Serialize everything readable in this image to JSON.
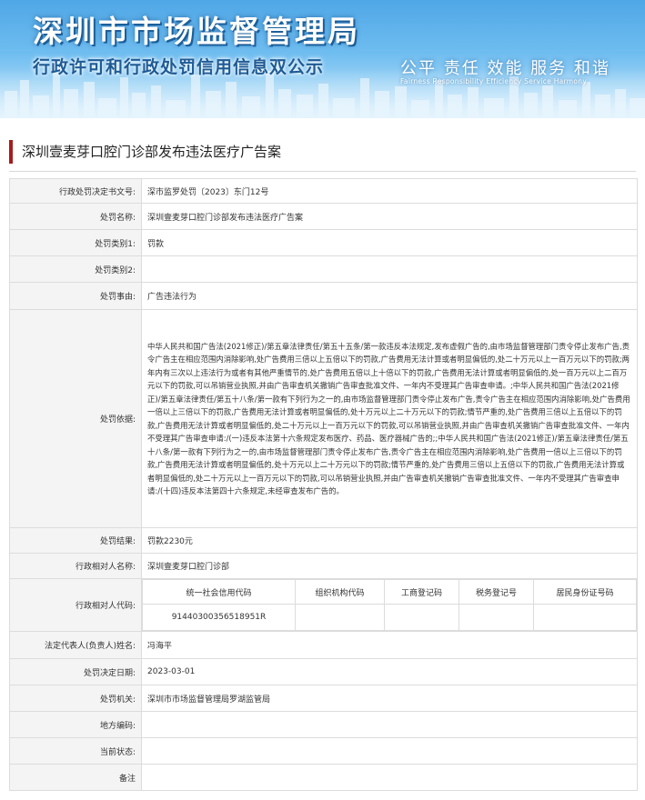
{
  "banner": {
    "title": "深圳市市场监督管理局",
    "subtitle": "行政许可和行政处罚信用信息双公示",
    "slogan": "公平  责任  效能  服务  和谐",
    "slogan_en": "Fairness  Responsibility  Efficiency  Service  Harmony"
  },
  "case_title": "深圳壹麦芽口腔门诊部发布违法医疗广告案",
  "rows": [
    {
      "label": "行政处罚决定书文号:",
      "value": "深市监罗处罚〔2023〕东门12号"
    },
    {
      "label": "处罚名称:",
      "value": "深圳壹麦芽口腔门诊部发布违法医疗广告案"
    },
    {
      "label": "处罚类别1:",
      "value": "罚款"
    },
    {
      "label": "处罚类别2:",
      "value": ""
    },
    {
      "label": "处罚事由:",
      "value": "广告违法行为"
    },
    {
      "label": "处罚依据:",
      "value": "中华人民共和国广告法(2021修正)/第五章法律责任/第五十五条/第一款违反本法规定,发布虚假广告的,由市场监督管理部门责令停止发布广告,责令广告主在相应范围内消除影响,处广告费用三倍以上五倍以下的罚款,广告费用无法计算或者明显偏低的,处二十万元以上一百万元以下的罚款;两年内有三次以上违法行为或者有其他严重情节的,处广告费用五倍以上十倍以下的罚款,广告费用无法计算或者明显偏低的,处一百万元以上二百万元以下的罚款,可以吊销营业执照,并由广告审查机关撤销广告审查批准文件、一年内不受理其广告审查申请。;中华人民共和国广告法(2021修正)/第五章法律责任/第五十八条/第一款有下列行为之一的,由市场监督管理部门责令停止发布广告,责令广告主在相应范围内消除影响,处广告费用一倍以上三倍以下的罚款,广告费用无法计算或者明显偏低的,处十万元以上二十万元以下的罚款;情节严重的,处广告费用三倍以上五倍以下的罚款,广告费用无法计算或者明显偏低的,处二十万元以上一百万元以下的罚款,可以吊销营业执照,并由广告审查机关撤销广告审查批准文件、一年内不受理其广告审查申请:/(一)违反本法第十六条规定发布医疗、药品、医疗器械广告的;;中华人民共和国广告法(2021修正)/第五章法律责任/第五十八条/第一款有下列行为之一的,由市场监督管理部门责令停止发布广告,责令广告主在相应范围内消除影响,处广告费用一倍以上三倍以下的罚款,广告费用无法计算或者明显偏低的,处十万元以上二十万元以下的罚款;情节严重的,处广告费用三倍以上五倍以下的罚款,广告费用无法计算或者明显偏低的,处二十万元以上一百万元以下的罚款,可以吊销营业执照,并由广告审查机关撤销广告审查批准文件、一年内不受理其广告审查申请:/(十四)违反本法第四十六条规定,未经审查发布广告的。"
    },
    {
      "label": "处罚结果:",
      "value": "罚款2230元"
    },
    {
      "label": "行政相对人名称:",
      "value": "深圳壹麦芽口腔门诊部"
    }
  ],
  "codes": {
    "label": "行政相对人代码:",
    "headers": [
      "统一社会信用代码",
      "组织机构代码",
      "工商登记码",
      "税务登记号",
      "居民身份证号码"
    ],
    "values": [
      "91440300356518951R",
      "",
      "",
      "",
      ""
    ]
  },
  "rows2": [
    {
      "label": "法定代表人(负责人)姓名:",
      "value": "冯海平"
    },
    {
      "label": "处罚决定日期:",
      "value": "2023-03-01"
    },
    {
      "label": "处罚机关:",
      "value": "深圳市市场监督管理局罗湖监管局"
    },
    {
      "label": "地方编码:",
      "value": ""
    },
    {
      "label": "当前状态:",
      "value": ""
    },
    {
      "label": "备注",
      "value": ""
    }
  ]
}
